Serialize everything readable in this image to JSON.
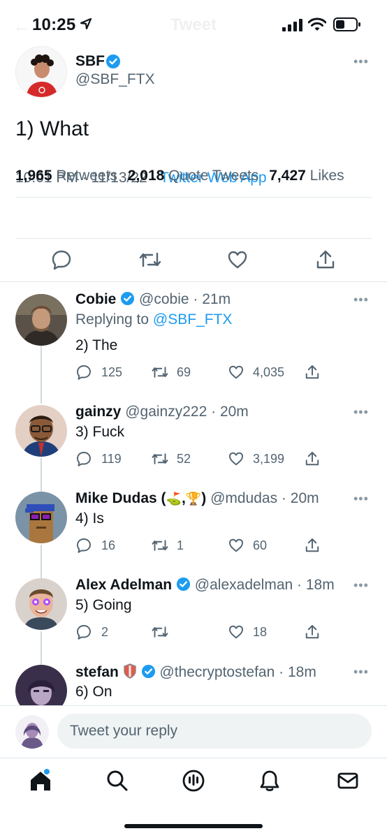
{
  "status_bar": {
    "time": "10:25",
    "ghost_title": "Tweet"
  },
  "main_tweet": {
    "author_name": "SBF",
    "author_handle": "@SBF_FTX",
    "text": "1) What",
    "timestamp": "10:01 PM · 11/13/22 · ",
    "source": "Twitter Web App",
    "stats": {
      "retweets_count": "1,965",
      "retweets_label": "Retweets",
      "quotes_count": "2,018",
      "quotes_label": "Quote Tweets",
      "likes_count": "7,427",
      "likes_label": "Likes"
    }
  },
  "replies": [
    {
      "name": "Cobie",
      "handle": "@cobie",
      "time": "21m",
      "replying_prefix": "Replying to ",
      "replying_to": "@SBF_FTX",
      "text": "2) The",
      "replies": "125",
      "retweets": "69",
      "likes": "4,035"
    },
    {
      "name": "gainzy",
      "handle": "@gainzy222",
      "time": "20m",
      "text": "3) Fuck",
      "replies": "119",
      "retweets": "52",
      "likes": "3,199"
    },
    {
      "name": "Mike Dudas (",
      "name_tail": ")",
      "name_emoji_1": "⛳",
      "name_sep": ",",
      "name_emoji_2": "🏆",
      "handle": "@mdudas",
      "time": "20m",
      "text": "4) Is",
      "replies": "16",
      "retweets": "1",
      "likes": "60"
    },
    {
      "name": "Alex Adelman",
      "handle": "@alexadelman",
      "time": "18m",
      "text": "5) Going",
      "replies": "2",
      "retweets": "",
      "likes": "18"
    },
    {
      "name": "stefan",
      "handle": "@thecryptostefan",
      "time": "18m",
      "text": "6) On"
    }
  ],
  "compose": {
    "placeholder": "Tweet your reply"
  },
  "icons": {
    "verified": "verified-badge-icon",
    "reply": "reply-icon",
    "retweet": "retweet-icon",
    "like": "heart-icon",
    "share": "share-icon",
    "home": "home-icon",
    "search": "search-icon",
    "spaces": "spaces-icon",
    "notifications": "bell-icon",
    "messages": "mail-icon"
  },
  "colors": {
    "accent": "#1d9bf0",
    "text": "#0f1419",
    "secondary": "#536471"
  }
}
